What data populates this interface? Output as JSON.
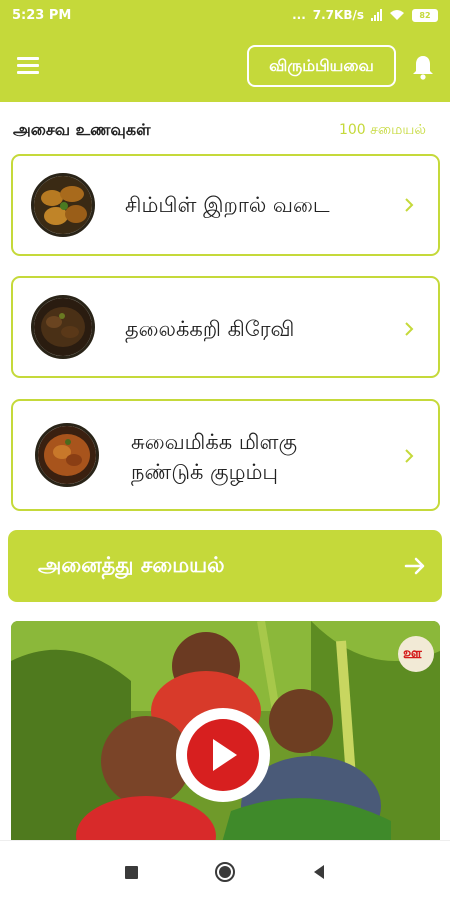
{
  "status_bar": {
    "time": "5:23 PM",
    "dots": "...",
    "speed": "7.7KB/s",
    "battery": "82"
  },
  "app_bar": {
    "favorites_label": "விரும்பியவை"
  },
  "section": {
    "title": "அசைவ உணவுகள்",
    "count": "100 சமையல்"
  },
  "recipes": [
    {
      "name": "சிம்பிள் இறால் வடை"
    },
    {
      "name": "தலைக்கறி கிரேவி"
    },
    {
      "name_line1": "சுவைமிக்க மிளகு",
      "name_line2": "நண்டுக் குழம்பு"
    }
  ],
  "all_recipes_label": "அனைத்து சமையல்",
  "video": {
    "badge": "ஊ"
  },
  "colors": {
    "accent": "#c5d93a",
    "text": "#222222"
  }
}
